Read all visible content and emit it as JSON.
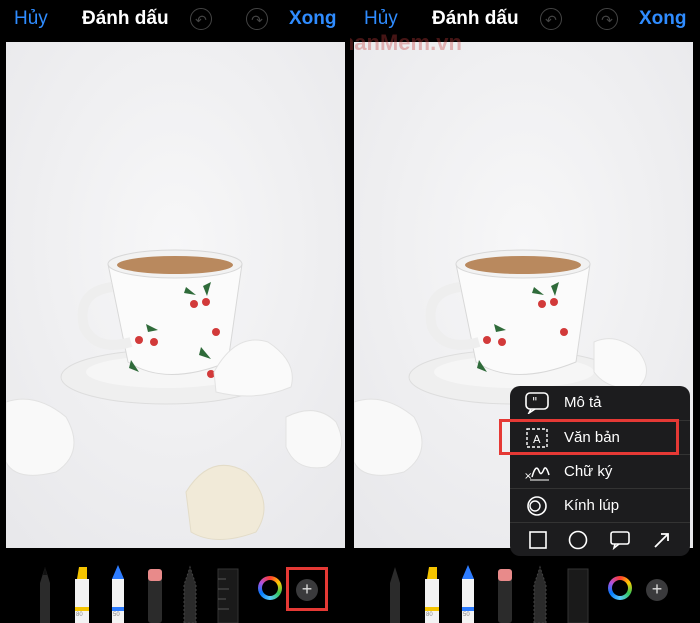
{
  "screens": [
    {
      "header": {
        "cancel_label": "Hủy",
        "title": "Đánh dấu",
        "done_label": "Xong"
      },
      "toolbar": {
        "pen_numbers": [
          "80",
          "50"
        ],
        "plus_label": "+"
      }
    },
    {
      "header": {
        "cancel_label": "Hủy",
        "title": "Đánh dấu",
        "done_label": "Xong"
      },
      "toolbar": {
        "pen_numbers": [
          "80",
          "50"
        ],
        "plus_label": "+"
      },
      "menu": {
        "items": [
          {
            "label": "Mô tả",
            "icon": "quote-bubble-icon"
          },
          {
            "label": "Văn bản",
            "icon": "text-box-icon"
          },
          {
            "label": "Chữ ký",
            "icon": "signature-icon"
          },
          {
            "label": "Kính lúp",
            "icon": "magnifier-icon"
          }
        ],
        "shapes": [
          "square-icon",
          "circle-icon",
          "speech-bubble-icon",
          "arrow-icon"
        ]
      }
    }
  ],
  "watermark": "ThuThuatPhanMem.vn",
  "colors": {
    "accent": "#2f8cff",
    "highlight": "#e53935",
    "menu_bg": "#1c1c1e"
  }
}
